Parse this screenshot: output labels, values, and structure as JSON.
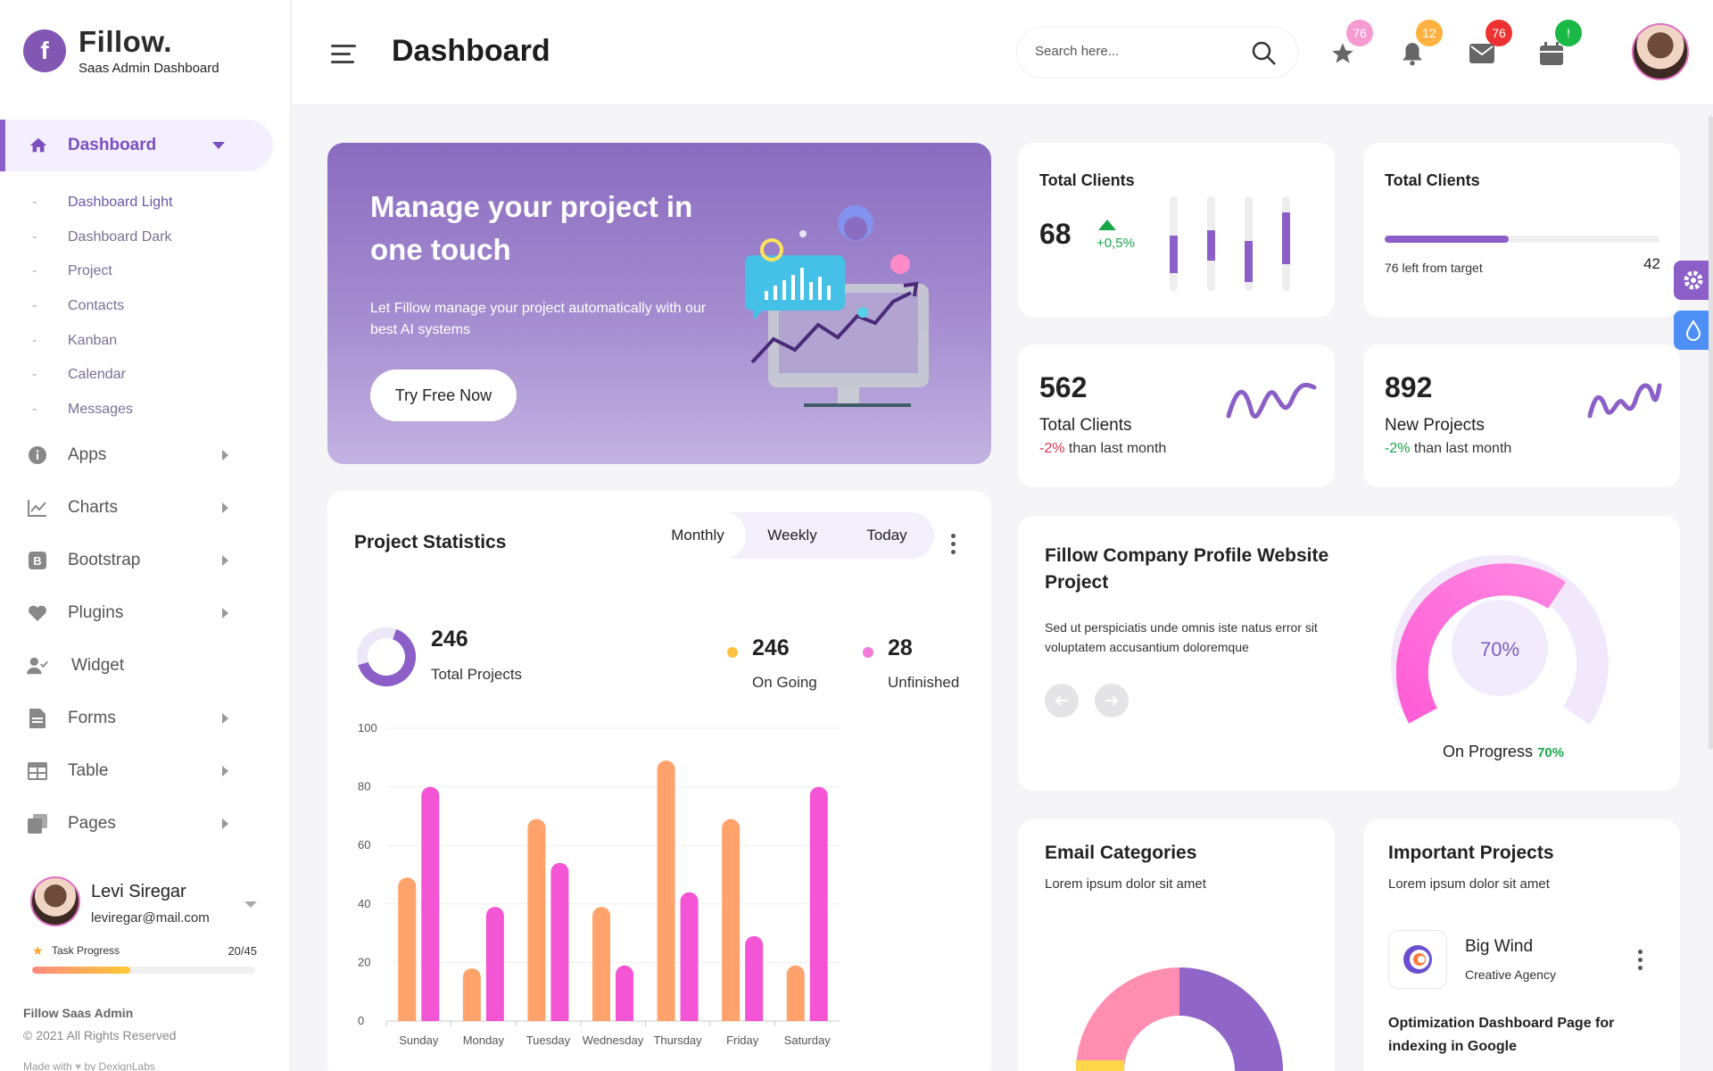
{
  "brand": {
    "name": "Fillow.",
    "subtitle": "Saas Admin Dashboard",
    "logo_letter": "f"
  },
  "sidebar": {
    "active": {
      "label": "Dashboard",
      "icon": "home-icon"
    },
    "sub_items": [
      "Dashboard Light",
      "Dashboard Dark",
      "Project",
      "Contacts",
      "Kanban",
      "Calendar",
      "Messages"
    ],
    "items": [
      {
        "label": "Apps",
        "icon": "info-icon",
        "has_arrow": true
      },
      {
        "label": "Charts",
        "icon": "chart-icon",
        "has_arrow": true
      },
      {
        "label": "Bootstrap",
        "icon": "bootstrap-icon",
        "has_arrow": true
      },
      {
        "label": "Plugins",
        "icon": "heart-icon",
        "has_arrow": true
      },
      {
        "label": "Widget",
        "icon": "user-check-icon",
        "has_arrow": false
      },
      {
        "label": "Forms",
        "icon": "document-icon",
        "has_arrow": true
      },
      {
        "label": "Table",
        "icon": "table-icon",
        "has_arrow": true
      },
      {
        "label": "Pages",
        "icon": "pages-icon",
        "has_arrow": true
      }
    ],
    "profile": {
      "name": "Levi Siregar",
      "email": "leviregar@mail.com"
    },
    "task": {
      "label": "Task Progress",
      "value": "20/45",
      "progress": 0.44
    },
    "footer": {
      "title": "Fillow Saas Admin",
      "copyright": "© 2021 All Rights Reserved",
      "made_with": "Made with",
      "by": "by DexignLabs"
    }
  },
  "header": {
    "title": "Dashboard",
    "search_placeholder": "Search here...",
    "badges": {
      "star": "76",
      "bell": "12",
      "mail": "76",
      "calendar": "!"
    },
    "colors": {
      "star": "#f59bd0",
      "bell": "#ffb23f",
      "mail": "#ee3232",
      "calendar": "#1ab845"
    }
  },
  "hero": {
    "title": "Manage your project in one touch",
    "description": "Let Fillow manage your project automatically with our best AI systems",
    "button": "Try Free Now"
  },
  "card_clients": {
    "title": "Total Clients",
    "value": "68",
    "change": "+0,5%"
  },
  "card_target": {
    "title": "Total Clients",
    "note": "76 left from target",
    "value": "42",
    "progress": 0.45
  },
  "card_total_clients": {
    "value": "562",
    "label": "Total Clients",
    "change": "-2%",
    "suffix": " than last month"
  },
  "card_new_projects": {
    "value": "892",
    "label": "New Projects",
    "change": "-2%",
    "suffix": " than last month"
  },
  "project_stats": {
    "title": "Project Statistics",
    "tabs": [
      "Monthly",
      "Weekly",
      "Today"
    ],
    "active_tab": "Monthly",
    "total": {
      "value": "246",
      "label": "Total Projects"
    },
    "on_going": {
      "value": "246",
      "label": "On Going",
      "color": "#ffc23d"
    },
    "unfinished": {
      "value": "28",
      "label": "Unfinished",
      "color": "#f27bd8"
    }
  },
  "chart_data": {
    "type": "bar",
    "categories": [
      "Sunday",
      "Monday",
      "Tuesday",
      "Wednesday",
      "Thursday",
      "Friday",
      "Saturday"
    ],
    "series": [
      {
        "values": [
          49,
          18,
          69,
          39,
          89,
          69,
          19
        ],
        "color": "#ffa26b"
      },
      {
        "values": [
          80,
          39,
          54,
          19,
          44,
          29,
          80
        ],
        "color": "#f455d4"
      }
    ],
    "ylim": [
      0,
      100
    ],
    "yticks": [
      0,
      20,
      40,
      60,
      80,
      100
    ]
  },
  "company_project": {
    "title": "Fillow Company Profile Website Project",
    "description": "Sed ut perspiciatis unde omnis iste natus error sit voluptatem accusantium doloremque",
    "percent_label": "70%",
    "progress": 0.7,
    "status_label": "On Progress",
    "status_value": "70%"
  },
  "email_categories": {
    "title": "Email Categories",
    "subtitle": "Lorem ipsum dolor sit amet"
  },
  "important_projects": {
    "title": "Important Projects",
    "subtitle": "Lorem ipsum dolor sit amet",
    "item": {
      "name": "Big Wind",
      "company": "Creative Agency",
      "task": "Optimization Dashboard Page for indexing in Google"
    }
  }
}
